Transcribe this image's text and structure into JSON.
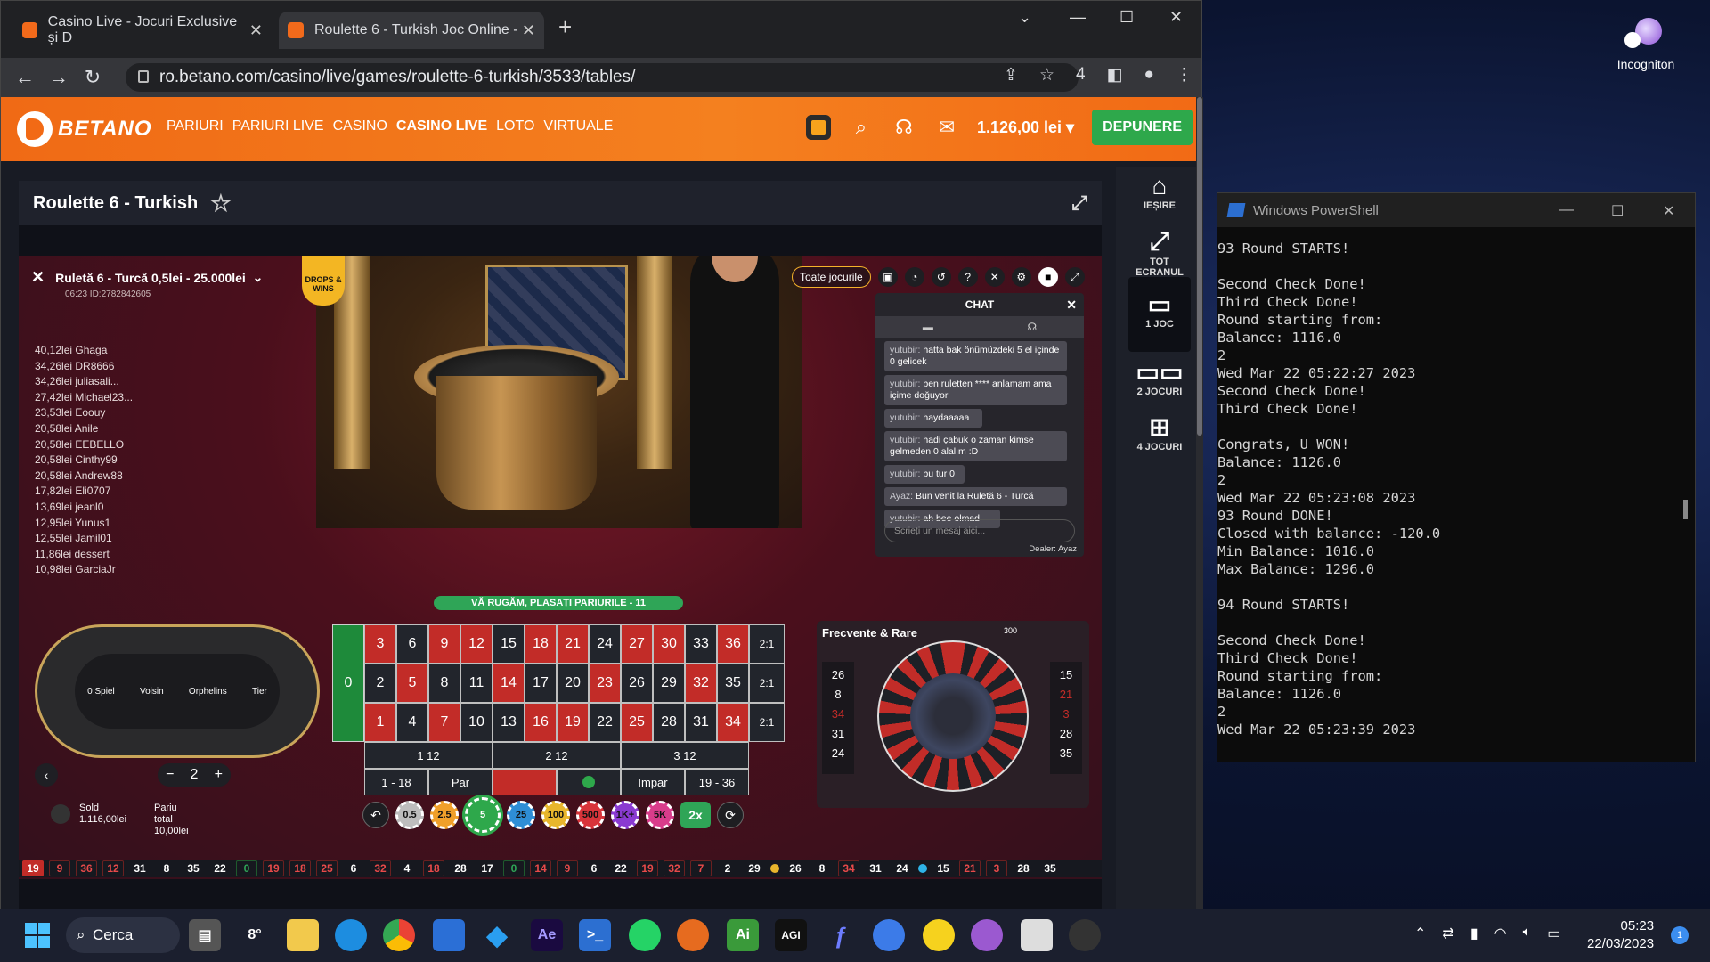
{
  "browser": {
    "tabs": [
      {
        "title": "Casino Live - Jocuri Exclusive și D"
      },
      {
        "title": "Roulette 6 - Turkish Joc Online - "
      }
    ],
    "url": "ro.betano.com/casino/live/games/roulette-6-turkish/3533/tables/",
    "bookmark_count": "4"
  },
  "site": {
    "logo": "BETANO",
    "nav": [
      "PARIURI",
      "PARIURI LIVE",
      "CASINO",
      "CASINO LIVE",
      "LOTO",
      "VIRTUALE"
    ],
    "balance": "1.126,00 lei",
    "deposit_label": "DEPUNERE",
    "game_title": "Roulette 6 - Turkish"
  },
  "side_panel": [
    {
      "icon": "home-icon",
      "label": "IEȘIRE"
    },
    {
      "icon": "fullscreen-icon",
      "label": "TOT ECRANUL"
    },
    {
      "icon": "single-game-icon",
      "label": "1 JOC"
    },
    {
      "icon": "two-games-icon",
      "label": "2 JOCURI"
    },
    {
      "icon": "four-games-icon",
      "label": "4 JOCURI"
    }
  ],
  "table": {
    "name": "Ruletă 6 - Turcă 0,5lei - 25.000lei",
    "sub": "06:23  ID:2782842605",
    "drops_badge": "DROPS & WINS",
    "all_games": "Toate jocurile",
    "banner": "VĂ RUGĂM, PLASAȚI PARIURILE - 11",
    "winners": [
      "40,12lei Ghaga",
      "34,26lei DR8666",
      "34,26lei juliasali...",
      "27,42lei Michael23...",
      "23,53lei Eoouy",
      "20,58lei Anile",
      "20,58lei EEBELLO",
      "20,58lei Cinthy99",
      "20,58lei Andrew88",
      "17,82lei Eli0707",
      "13,69lei jeanl0",
      "12,95lei Yunus1",
      "12,55lei Jamil01",
      "11,86lei dessert",
      "10,98lei GarciaJr"
    ],
    "racetrack_labels": [
      "0 Spiel",
      "Voisin",
      "Orphelins",
      "Tier"
    ],
    "zero": "0",
    "grid_rows": [
      [
        "3",
        "6",
        "9",
        "12",
        "15",
        "18",
        "21",
        "24",
        "27",
        "30",
        "33",
        "36",
        "2:1"
      ],
      [
        "2",
        "5",
        "8",
        "11",
        "14",
        "17",
        "20",
        "23",
        "26",
        "29",
        "32",
        "35",
        "2:1"
      ],
      [
        "1",
        "4",
        "7",
        "10",
        "13",
        "16",
        "19",
        "22",
        "25",
        "28",
        "31",
        "34",
        "2:1"
      ]
    ],
    "dozens": [
      "1 12",
      "2 12",
      "3 12"
    ],
    "outside": [
      "1 - 18",
      "Par",
      "",
      "",
      "Impar",
      "19 - 36"
    ],
    "chips": [
      "0.5",
      "2.5",
      "5",
      "25",
      "100",
      "500",
      "1K+",
      "5K"
    ],
    "double": "2x",
    "stake": "2",
    "sold_label": "Sold",
    "sold_value": "1.116,00lei",
    "total_label": "Pariu total",
    "total_value": "10,00lei",
    "history": [
      "19",
      "9",
      "36",
      "12",
      "31",
      "8",
      "35",
      "22",
      "0",
      "19",
      "18",
      "25",
      "6",
      "32",
      "4",
      "18",
      "28",
      "17",
      "0",
      "14",
      "9",
      "6",
      "22",
      "19",
      "32",
      "7",
      "2",
      "29"
    ],
    "hot": [
      "26",
      "8",
      "34",
      "31",
      "24"
    ],
    "cold": [
      "15",
      "21",
      "3",
      "28",
      "35"
    ]
  },
  "chat": {
    "title": "CHAT",
    "messages": [
      {
        "user": "yutubir:",
        "text": "hatta bak önümüzdeki 5 el içinde 0 gelicek"
      },
      {
        "user": "yutubir:",
        "text": "ben ruletten **** anlamam ama içime doğuyor"
      },
      {
        "user": "yutubir:",
        "text": "haydaaaaa"
      },
      {
        "user": "yutubir:",
        "text": "hadi çabuk o zaman kimse gelmeden 0 alalım :D"
      },
      {
        "user": "yutubir:",
        "text": "bu tur 0"
      },
      {
        "user": "Ayaz:",
        "text": "Bun venit la Ruletă 6 - Turcă"
      },
      {
        "user": "yutubir:",
        "text": "ah bee olmadı"
      }
    ],
    "placeholder": "Scrieți un mesaj aici...",
    "dealer": "Dealer: Ayaz"
  },
  "freq": {
    "title": "Frecvente & Rare",
    "count": "300",
    "hot": [
      "26",
      "8",
      "34",
      "31",
      "24"
    ],
    "cold": [
      "15",
      "21",
      "3",
      "28",
      "35"
    ]
  },
  "powershell": {
    "title": "Windows PowerShell",
    "lines": "93 Round STARTS!\n\nSecond Check Done!\nThird Check Done!\nRound starting from:\nBalance: 1116.0\n2\nWed Mar 22 05:22:27 2023\nSecond Check Done!\nThird Check Done!\n\nCongrats, U WON!\nBalance: 1126.0\n2\nWed Mar 22 05:23:08 2023\n93 Round DONE!\nClosed with balance: -120.0\nMin Balance: 1016.0\nMax Balance: 1296.0\n\n94 Round STARTS!\n\nSecond Check Done!\nThird Check Done!\nRound starting from:\nBalance: 1126.0\n2\nWed Mar 22 05:23:39 2023"
  },
  "desktop": {
    "incognito_label": "Incogniton"
  },
  "taskbar": {
    "search": "Cerca",
    "weather": "8°",
    "time": "05:23",
    "date": "22/03/2023",
    "notif": "1",
    "app_labels": [
      "Ae",
      "Ai",
      "AGI"
    ]
  }
}
